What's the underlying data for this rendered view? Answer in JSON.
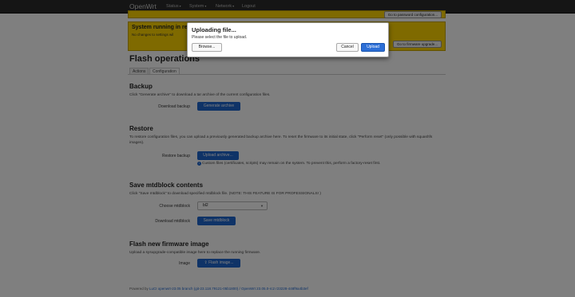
{
  "navbar": {
    "brand": "OpenWrt",
    "items": [
      {
        "label": "Status",
        "dropdown": true
      },
      {
        "label": "System",
        "dropdown": true
      },
      {
        "label": "Network",
        "dropdown": true
      },
      {
        "label": "Logout",
        "dropdown": false
      }
    ]
  },
  "alerts": [
    {
      "title": "",
      "text": "",
      "button": "Go to password configuration..."
    },
    {
      "title": "System running in re",
      "text": "No changes to settings wil",
      "button": "Go to firmware upgrade..."
    }
  ],
  "page": {
    "title": "Flash operations",
    "tabs": [
      "Actions",
      "Configuration"
    ]
  },
  "sections": {
    "backup": {
      "title": "Backup",
      "desc": "Click \"Generate archive\" to download a tar archive of the current configuration files.",
      "label": "Download backup",
      "button": "Generate archive"
    },
    "restore": {
      "title": "Restore",
      "desc": "To restore configuration files, you can upload a previously generated backup archive here. To reset the firmware to its initial state, click \"Perform reset\" (only possible with squashfs images).",
      "label": "Restore backup",
      "button": "Upload archive...",
      "help": "Custom files (certificates, scripts) may remain on the system. To prevent this, perform a factory-reset first."
    },
    "mtd": {
      "title": "Save mtdblock contents",
      "desc": "Click \"Save mtdblock\" to download specified mtdblock file. (NOTE: THIS FEATURE IS FOR PROFESSIONALS! )",
      "choose_label": "Choose mtdblock",
      "selected": "bl2",
      "download_label": "Download mtdblock",
      "button": "Save mtdblock"
    },
    "flash": {
      "title": "Flash new firmware image",
      "desc": "Upload a sysupgrade-compatible image here to replace the running firmware.",
      "label": "Image",
      "button": "Flash image..."
    }
  },
  "footer": {
    "prefix": "Powered by ",
    "link": "LuCI openwrt-23.05 branch (git-23.118.79121-05b1800) / OpenWrt 23.05.0-rc2 r23228-448f9a4b3ef",
    "middle": ""
  },
  "modal": {
    "title": "Uploading file...",
    "text": "Please select the file to upload.",
    "browse": "Browse...",
    "cancel": "Cancel",
    "upload": "Upload"
  },
  "colors": {
    "accent": "#1e66cf",
    "alert": "#ffd400",
    "navbar": "#2a2a2a"
  }
}
